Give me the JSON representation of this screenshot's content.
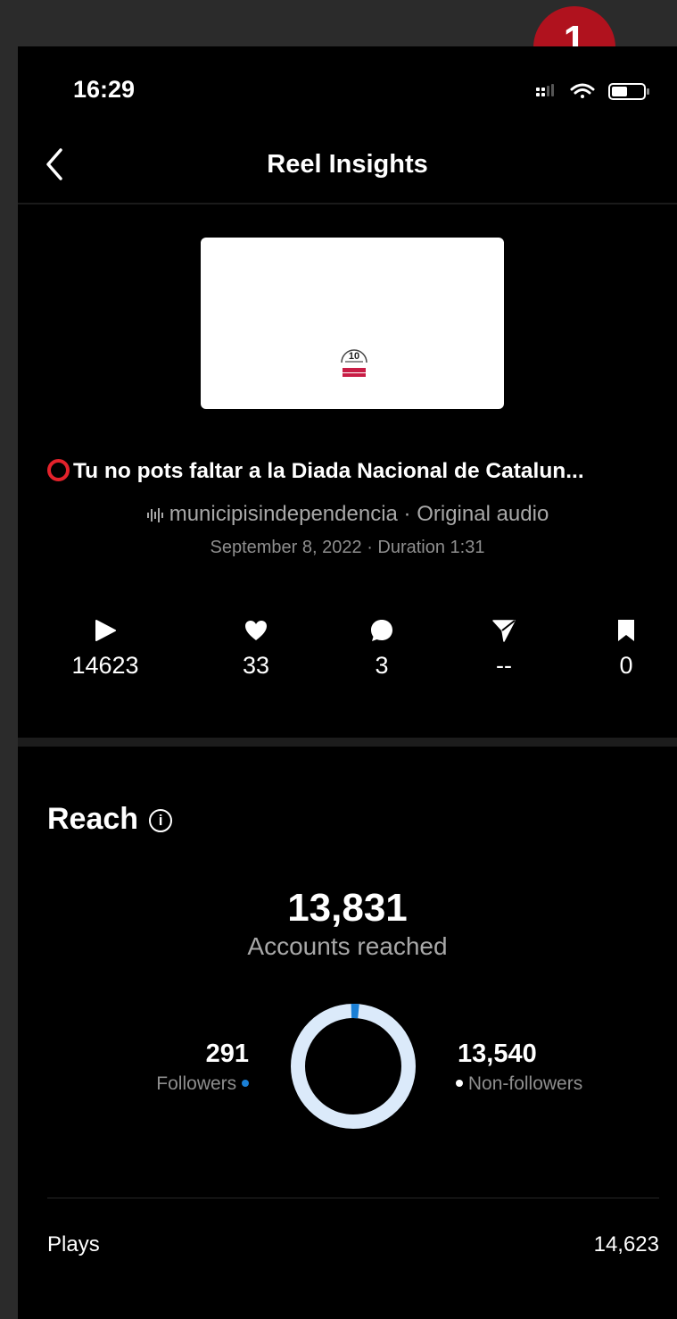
{
  "badge": {
    "number": "1"
  },
  "status_bar": {
    "time": "16:29"
  },
  "nav": {
    "title": "Reel Insights"
  },
  "reel": {
    "title": "Tu no pots faltar a la Diada Nacional de Catalun...",
    "account": "municipisindependencia",
    "audio_suffix": "· Original audio",
    "date": "September 8, 2022",
    "duration": "· Duration 1:31",
    "thumbnail_logo_text": "10"
  },
  "stats": {
    "plays": "14623",
    "likes": "33",
    "comments": "3",
    "shares": "--",
    "saves": "0"
  },
  "reach": {
    "heading": "Reach",
    "total": "13,831",
    "total_label": "Accounts reached",
    "followers_value": "291",
    "followers_label": "Followers",
    "non_followers_value": "13,540",
    "non_followers_label": "Non-followers",
    "followers_share": 0.021,
    "colors": {
      "followers": "#1a7fd6",
      "non_followers": "#dbeafa"
    }
  },
  "plays_row": {
    "label": "Plays",
    "value": "14,623"
  }
}
